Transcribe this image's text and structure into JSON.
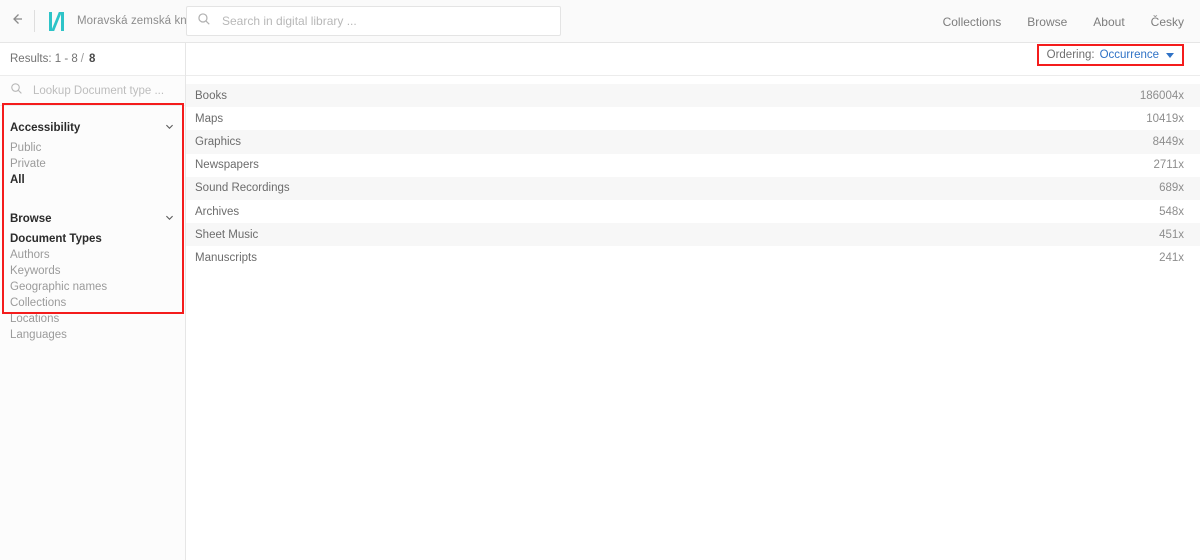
{
  "header": {
    "back_icon": "arrow-left-icon",
    "logo_alt": "mzk-logo",
    "brand_name": "Moravská zemská knihovna",
    "search": {
      "icon": "search-icon",
      "placeholder": "Search in digital library ...",
      "value": ""
    },
    "nav": [
      {
        "label": "Collections"
      },
      {
        "label": "Browse"
      },
      {
        "label": "About"
      },
      {
        "label": "Česky"
      }
    ]
  },
  "sidebar": {
    "results": {
      "prefix": "Results:",
      "range": "1 - 8",
      "separator": "/",
      "total": "8"
    },
    "lookup": {
      "icon": "search-icon",
      "placeholder": "Lookup Document type ...",
      "value": ""
    },
    "facets": [
      {
        "title": "Accessibility",
        "chevron": "chevron-down-icon",
        "items": [
          {
            "label": "Public",
            "selected": false
          },
          {
            "label": "Private",
            "selected": false
          },
          {
            "label": "All",
            "selected": true
          }
        ]
      },
      {
        "title": "Browse",
        "chevron": "chevron-down-icon",
        "items": [
          {
            "label": "Document Types",
            "selected": true
          },
          {
            "label": "Authors",
            "selected": false
          },
          {
            "label": "Keywords",
            "selected": false
          },
          {
            "label": "Geographic names",
            "selected": false
          },
          {
            "label": "Collections",
            "selected": false
          },
          {
            "label": "Locations",
            "selected": false
          },
          {
            "label": "Languages",
            "selected": false
          }
        ]
      }
    ]
  },
  "main": {
    "ordering": {
      "label": "Ordering:",
      "value": "Occurrence",
      "caret_icon": "caret-down-icon"
    },
    "rows": [
      {
        "label": "Books",
        "count": "186004x"
      },
      {
        "label": "Maps",
        "count": "10419x"
      },
      {
        "label": "Graphics",
        "count": "8449x"
      },
      {
        "label": "Newspapers",
        "count": "2711x"
      },
      {
        "label": "Sound Recordings",
        "count": "689x"
      },
      {
        "label": "Archives",
        "count": "548x"
      },
      {
        "label": "Sheet Music",
        "count": "451x"
      },
      {
        "label": "Manuscripts",
        "count": "241x"
      }
    ]
  },
  "colors": {
    "brand_teal": "#2ec4c8",
    "link_blue": "#2f72c6",
    "annotation_red": "#f41c1c",
    "row_alt": "#f7f7f7"
  }
}
